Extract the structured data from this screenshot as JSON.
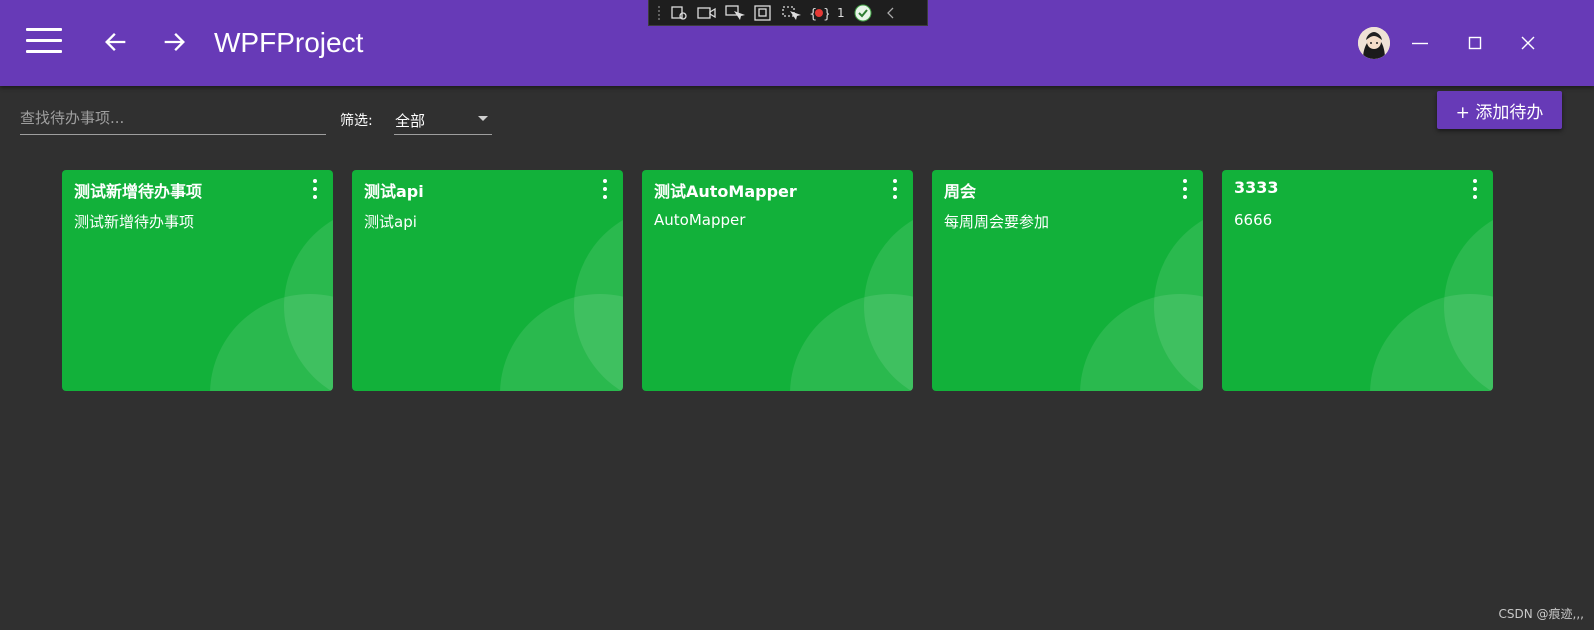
{
  "app": {
    "title": "WPFProject"
  },
  "debug_toolbar": {
    "issue_count": "1"
  },
  "toolbar": {
    "search_placeholder": "查找待办事项...",
    "filter_label": "筛选:",
    "filter_value": "全部",
    "add_button_label": "+ 添加待办"
  },
  "todos": [
    {
      "title": "测试新增待办事项",
      "content": "测试新增待办事项"
    },
    {
      "title": "测试api",
      "content": "测试api"
    },
    {
      "title": "测试AutoMapper",
      "content": "AutoMapper"
    },
    {
      "title": "周会",
      "content": "每周周会要参加"
    },
    {
      "title": "3333",
      "content": "6666"
    }
  ],
  "watermark": "CSDN @痕迹,,,",
  "colors": {
    "primary": "#673ab7",
    "background": "#303030",
    "card": "#12b13a"
  },
  "icons": [
    "menu-icon",
    "arrow-left-icon",
    "arrow-right-icon",
    "minimize-icon",
    "maximize-icon",
    "close-icon",
    "more-vert-icon",
    "caret-down-icon"
  ]
}
